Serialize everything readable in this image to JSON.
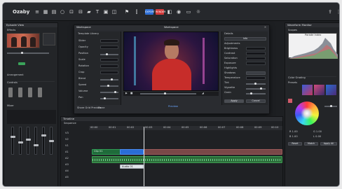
{
  "app": {
    "name": "Ozaby"
  },
  "toolbar": {
    "btn_red1": "EXPORT",
    "btn_red2": "RENDER",
    "accent_blue": "#2f6fd6",
    "accent_red": "#d33a3a"
  },
  "left": {
    "media_title": "Episode View",
    "section1": "Effects",
    "section2": "Arrangement",
    "section3": "Controls",
    "section4": "Mixer"
  },
  "viewer": {
    "header_left": "Workspace",
    "header_center": "Workspace",
    "side_title": "Template Library",
    "footer_left": "Share Grid Preview",
    "footer_right": "Done",
    "options": [
      "Slider",
      "Opacity",
      "Position",
      "Scale",
      "Rotation",
      "Crop",
      "Blend",
      "Speed",
      "Volume",
      "Pan"
    ],
    "status": "Preview"
  },
  "inspector": {
    "title": "Details",
    "tab": "Info",
    "labels": [
      "Adjustments",
      "Brightness",
      "Contrast",
      "Saturation",
      "Exposure",
      "Highlights",
      "Shadows",
      "Temperature",
      "Tint",
      "Vignette",
      "Grain",
      "Sharpen",
      "Clarity",
      "Dehaze"
    ],
    "apply": "Apply",
    "cancel": "Cancel"
  },
  "right": {
    "histogram_title": "Waveform Monitor",
    "histogram_sub": "Scopes",
    "histogram_label": "Parade Index",
    "grading_title": "Color Grading",
    "swatches_label": "Presets",
    "values": [
      "R 1.00",
      "G 1.00",
      "B 1.00",
      "L 0.00"
    ],
    "btns": [
      "Reset",
      "Match",
      "Apply All"
    ]
  },
  "timeline": {
    "title": "Timeline",
    "sub": "Sequence",
    "timecodes": [
      "00:00",
      "00:01",
      "00:02",
      "00:03",
      "00:04",
      "00:05",
      "00:06",
      "00:07",
      "00:08",
      "00:09",
      "00:10"
    ],
    "tracks": [
      "V3",
      "V2",
      "V1",
      "A1",
      "A2",
      "A3",
      "A4",
      "A5"
    ],
    "clip_label": "Clip 01",
    "clip_label2": "Audio 01"
  }
}
